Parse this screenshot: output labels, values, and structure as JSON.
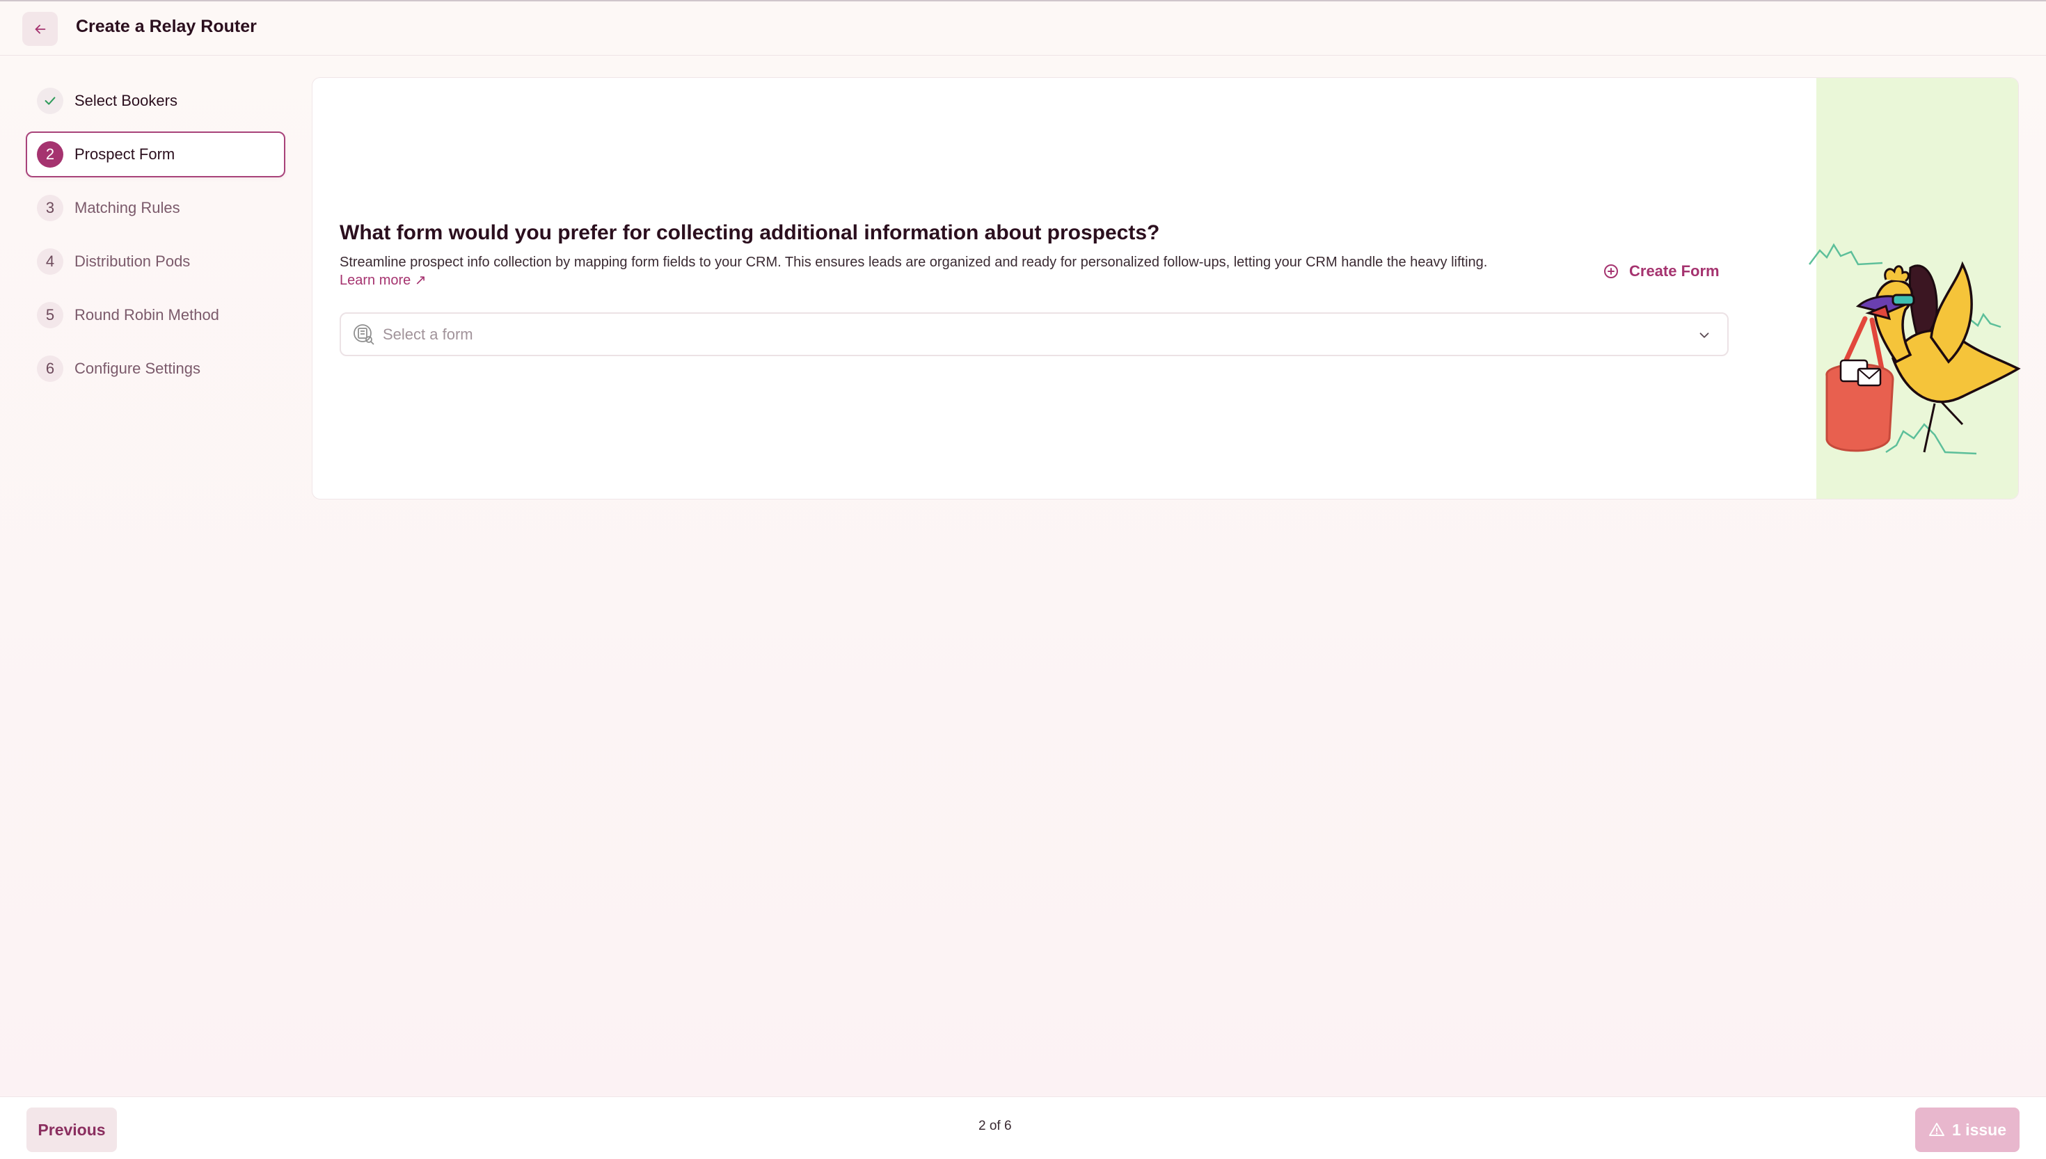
{
  "header": {
    "title": "Create a Relay Router",
    "back_icon": "arrow-left-icon"
  },
  "steps": [
    {
      "badge": "",
      "label": "Select Bookers",
      "state": "done"
    },
    {
      "badge": "2",
      "label": "Prospect Form",
      "state": "active"
    },
    {
      "badge": "3",
      "label": "Matching Rules",
      "state": "todo"
    },
    {
      "badge": "4",
      "label": "Distribution Pods",
      "state": "todo"
    },
    {
      "badge": "5",
      "label": "Round Robin Method",
      "state": "todo"
    },
    {
      "badge": "6",
      "label": "Configure Settings",
      "state": "todo"
    }
  ],
  "main": {
    "question": "What form would you prefer for collecting additional information about prospects?",
    "description": "Streamline prospect info collection by mapping form fields to your CRM. This ensures leads are organized and ready for personalized follow-ups, letting your CRM handle the heavy lifting.",
    "learn_more": "Learn more ↗",
    "create_form": "Create Form",
    "select_placeholder": "Select a form"
  },
  "footer": {
    "previous": "Previous",
    "pager": "2 of 6",
    "issue": "1 issue"
  },
  "colors": {
    "accent": "#a5336f",
    "art_bg": "#eaf7d8",
    "check": "#2e9b5a"
  }
}
